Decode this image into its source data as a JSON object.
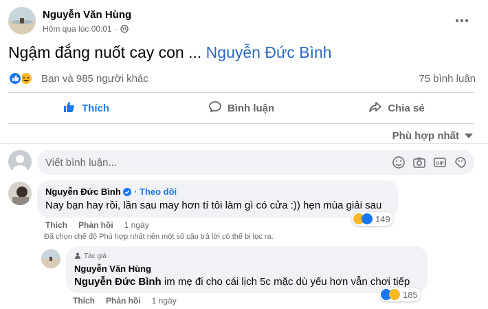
{
  "post": {
    "author": "Nguyễn Văn Hùng",
    "timestamp": "Hôm qua lúc 00:01 ·",
    "text": "Ngậm đắng nuốt cay con ...",
    "mention": "Nguyễn Đức Bình",
    "reactions_text": "Bạn và 985 người khác",
    "comment_count": "75 bình luận",
    "reaction_icons": [
      "like-icon",
      "haha-icon"
    ]
  },
  "actions": {
    "like": "Thích",
    "comment": "Bình luận",
    "share": "Chia sẻ"
  },
  "sort": {
    "label": "Phù hợp nhất"
  },
  "comment_input": {
    "placeholder": "Viết bình luận...",
    "icons": [
      "emoji-icon",
      "camera-icon",
      "gif-icon",
      "sticker-icon"
    ]
  },
  "comments": [
    {
      "author": "Nguyễn Đức Bình",
      "verified": true,
      "follow": "· Theo dõi",
      "text": "Nay bạn hay rồi, lần sau may hơn tí tôi làm gì có cửa :)) hẹn mùa giải sau",
      "like_label": "Thích",
      "reply_label": "Phản hồi",
      "time": "1 ngày",
      "reaction_count": "149"
    },
    {
      "author_badge": "Tác giả",
      "author": "Nguyễn Văn Hùng",
      "mention": "Nguyễn Đức Bình",
      "text": "im mẹ đi cho cái lịch 5c mặc dù yếu hơn vẫn chơi tiếp",
      "like_label": "Thích",
      "reply_label": "Phản hồi",
      "time": "1 ngày",
      "reaction_count": "185"
    }
  ],
  "notice": "Đã chọn chế độ Phù hợp nhất nên một số câu trả lời có thể bị lọc ra.",
  "colors": {
    "accent": "#1877f2",
    "mention": "#2d68c4",
    "secondary_text": "#65676b",
    "bubble": "#f0f2f5"
  }
}
